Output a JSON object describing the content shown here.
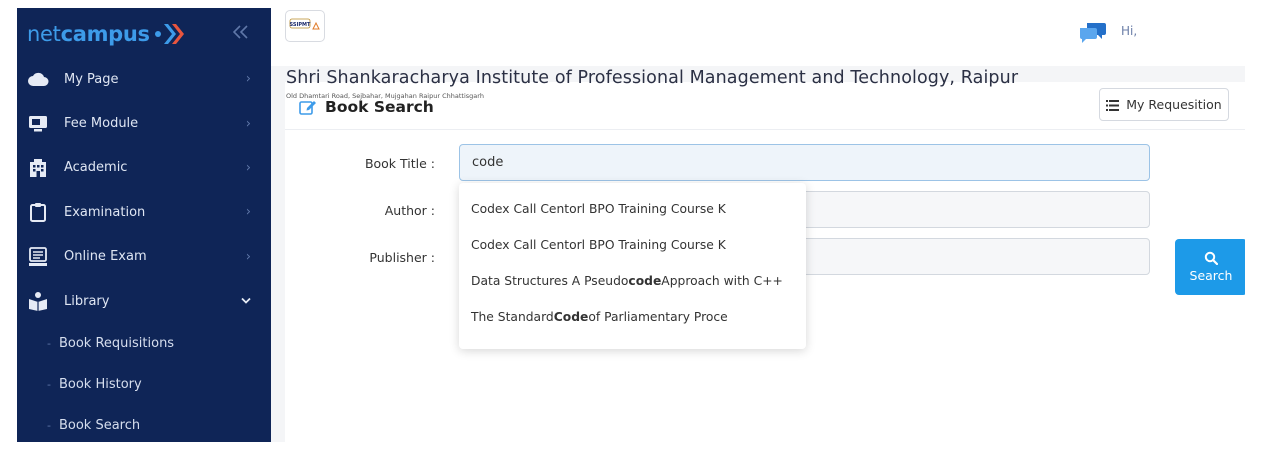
{
  "brand": {
    "part1": "net",
    "part2": "campus"
  },
  "sidebar": {
    "items": [
      {
        "label": "My Page",
        "icon": "cloud-icon"
      },
      {
        "label": "Fee Module",
        "icon": "monitor-icon"
      },
      {
        "label": "Academic",
        "icon": "building-icon"
      },
      {
        "label": "Examination",
        "icon": "clipboard-icon"
      },
      {
        "label": "Online Exam",
        "icon": "computer-icon"
      },
      {
        "label": "Library",
        "icon": "reader-icon"
      }
    ],
    "library_sub": [
      {
        "label": "Book Requisitions"
      },
      {
        "label": "Book History"
      },
      {
        "label": "Book Search"
      }
    ]
  },
  "header": {
    "logo_text": "SSIPMT",
    "greeting": "Hi,",
    "institute_name": "Shri Shankaracharya Institute of Professional Management and Technology, Raipur",
    "institute_address": "Old Dhamtari Road, Sejbahar, Mujgahan Raipur Chhattisgarh"
  },
  "page": {
    "title": "Book Search",
    "requisition_button": "My Requesition",
    "search_button": "Search"
  },
  "form": {
    "book_title_label": "Book Title :",
    "book_title_value": "code",
    "author_label": "Author :",
    "author_value": "",
    "publisher_label": "Publisher :",
    "publisher_value": ""
  },
  "autocomplete": [
    {
      "pre": "Codex Call Centorl BPO Training Course K",
      "match": "",
      "post": ""
    },
    {
      "pre": "Codex Call Centorl BPO Training Course K",
      "match": "",
      "post": ""
    },
    {
      "pre": "Data Structures A Pseudo",
      "match": "code",
      "post": " Approach with C++"
    },
    {
      "pre": "The Standard ",
      "match": "Code",
      "post": " of Parliamentary Proce"
    }
  ],
  "colors": {
    "sidebar_bg": "#0f2557",
    "brand_blue": "#3d9be9",
    "search_button": "#1d9ae8"
  }
}
